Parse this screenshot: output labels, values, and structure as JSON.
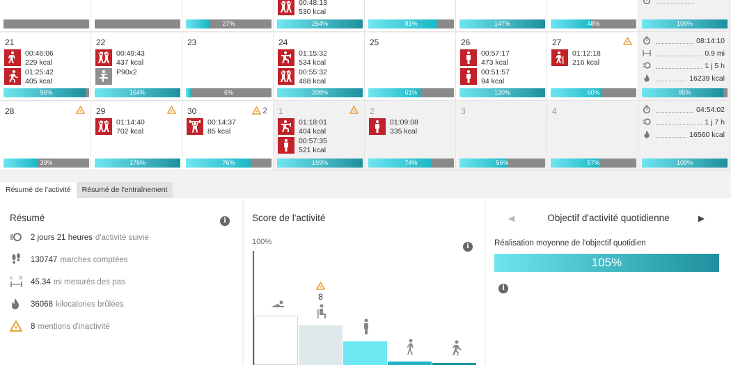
{
  "calendar": {
    "week0": {
      "cells": [
        {
          "bar": {
            "label": "",
            "pct": 0
          }
        },
        {
          "bar": {
            "label": "",
            "pct": 0
          }
        },
        {
          "bar": {
            "label": "27%",
            "pct": 27
          }
        },
        {
          "entries": [
            {
              "icon": "dance-icon",
              "time": "00:48:13",
              "kcal": "530 kcal"
            }
          ],
          "bar": {
            "label": "254%",
            "pct": 100
          }
        },
        {
          "bar": {
            "label": "81%",
            "pct": 81
          }
        },
        {
          "bar": {
            "label": "147%",
            "pct": 100
          }
        },
        {
          "bar": {
            "label": "48%",
            "pct": 48
          }
        }
      ],
      "summary": {
        "bar": {
          "label": "109%",
          "pct": 100
        }
      }
    },
    "week1": {
      "cells": [
        {
          "day": "21",
          "entries": [
            {
              "icon": "walk-icon",
              "time": "00:46:06",
              "kcal": "229 kcal"
            },
            {
              "icon": "run-icon",
              "time": "01:25:42",
              "kcal": "405 kcal"
            }
          ],
          "bar": {
            "label": "96%",
            "pct": 96
          }
        },
        {
          "day": "22",
          "entries": [
            {
              "icon": "dance-icon",
              "time": "00:49:43",
              "kcal": "437 kcal"
            },
            {
              "icon": "bike-icon",
              "time": "P90x2",
              "kcal": ""
            }
          ],
          "bar": {
            "label": "164%",
            "pct": 100
          }
        },
        {
          "day": "23",
          "bar": {
            "label": "6%",
            "pct": 6
          }
        },
        {
          "day": "24",
          "entries": [
            {
              "icon": "workout-icon",
              "time": "01:15:32",
              "kcal": "534 kcal"
            },
            {
              "icon": "dance-icon",
              "time": "00:55:32",
              "kcal": "488 kcal"
            }
          ],
          "bar": {
            "label": "208%",
            "pct": 100
          }
        },
        {
          "day": "25",
          "bar": {
            "label": "61%",
            "pct": 61
          }
        },
        {
          "day": "26",
          "entries": [
            {
              "icon": "stand-icon",
              "time": "00:57:17",
              "kcal": "473 kcal"
            },
            {
              "icon": "stand-icon",
              "time": "00:51:57",
              "kcal": "94 kcal"
            }
          ],
          "bar": {
            "label": "130%",
            "pct": 100
          }
        },
        {
          "day": "27",
          "warn": "",
          "entries": [
            {
              "icon": "hike-icon",
              "time": "01:12:18",
              "kcal": "216 kcal"
            }
          ],
          "bar": {
            "label": "60%",
            "pct": 60
          }
        }
      ],
      "summary": {
        "lines": [
          {
            "icon": "stopwatch-icon",
            "value": "08:14:10"
          },
          {
            "icon": "distance-icon",
            "value": "0.9 mi"
          },
          {
            "icon": "activity-icon",
            "value": "1 j 5 h"
          },
          {
            "icon": "flame-icon",
            "value": "16239 kcal"
          }
        ],
        "bar": {
          "label": "95%",
          "pct": 95
        }
      }
    },
    "week2": {
      "cells": [
        {
          "day": "28",
          "warn": "",
          "bar": {
            "label": "39%",
            "pct": 39
          }
        },
        {
          "day": "29",
          "warn": "",
          "entries": [
            {
              "icon": "dance-icon",
              "time": "01:14:40",
              "kcal": "702 kcal"
            }
          ],
          "bar": {
            "label": "176%",
            "pct": 100
          }
        },
        {
          "day": "30",
          "warn": "2",
          "entries": [
            {
              "icon": "lift-icon",
              "time": "00:14:37",
              "kcal": "85 kcal"
            }
          ],
          "bar": {
            "label": "76%",
            "pct": 76
          }
        },
        {
          "day": "1",
          "warn": "",
          "entries": [
            {
              "icon": "workout-icon",
              "time": "01:18:01",
              "kcal": "404 kcal"
            },
            {
              "icon": "stand-icon",
              "time": "00:57:35",
              "kcal": "521 kcal"
            }
          ],
          "bar": {
            "label": "199%",
            "pct": 100
          }
        },
        {
          "day": "2",
          "entries": [
            {
              "icon": "stand-icon",
              "time": "01:09:08",
              "kcal": "335 kcal"
            }
          ],
          "bar": {
            "label": "74%",
            "pct": 74
          }
        },
        {
          "day": "3",
          "bar": {
            "label": "56%",
            "pct": 56
          }
        },
        {
          "day": "4",
          "bar": {
            "label": "57%",
            "pct": 57
          }
        }
      ],
      "summary": {
        "lines": [
          {
            "icon": "stopwatch-icon",
            "value": "04:54:02"
          },
          {
            "icon": "activity-icon",
            "value": "1 j 7 h"
          },
          {
            "icon": "flame-icon",
            "value": "16560 kcal"
          }
        ],
        "bar": {
          "label": "109%",
          "pct": 100
        }
      }
    }
  },
  "tabs": [
    {
      "label": "Résumé de l'activité",
      "active": true
    },
    {
      "label": "Résumé de l'entraînement",
      "active": false
    }
  ],
  "resume": {
    "title": "Résumé",
    "rows": [
      {
        "icon": "activity-icon",
        "value": "2 jours 21 heures",
        "label": "d'activité suivie"
      },
      {
        "icon": "footsteps-icon",
        "value": "130747",
        "label": "marches comptées"
      },
      {
        "icon": "distance-icon",
        "value": "45.34",
        "label": "mi mesurés des pas"
      },
      {
        "icon": "flame-icon",
        "value": "36068",
        "label": "kilocalories brûlées"
      },
      {
        "icon": "inactivity-icon",
        "value": "8",
        "label": "mentions d'inactivité"
      }
    ]
  },
  "score": {
    "title": "Score de l'activité",
    "top_label": "100%",
    "inactivity_count": "8",
    "bars": [
      {
        "icon": "lying-icon",
        "level": 0.43,
        "color": "#ffffff"
      },
      {
        "icon": "sitting-icon",
        "level": 0.35,
        "color": "#dde9ea"
      },
      {
        "icon": "standing-icon",
        "level": 0.21,
        "color": "#6ee8f2"
      },
      {
        "icon": "walking-icon",
        "level": 0.03,
        "color": "#22b3c2"
      },
      {
        "icon": "running-icon",
        "level": 0.02,
        "color": "#17929f"
      }
    ]
  },
  "goal": {
    "title": "Objectif d'activité quotidienne",
    "subtitle": "Réalisation moyenne de l'objectif quotidien",
    "value": "105%"
  }
}
